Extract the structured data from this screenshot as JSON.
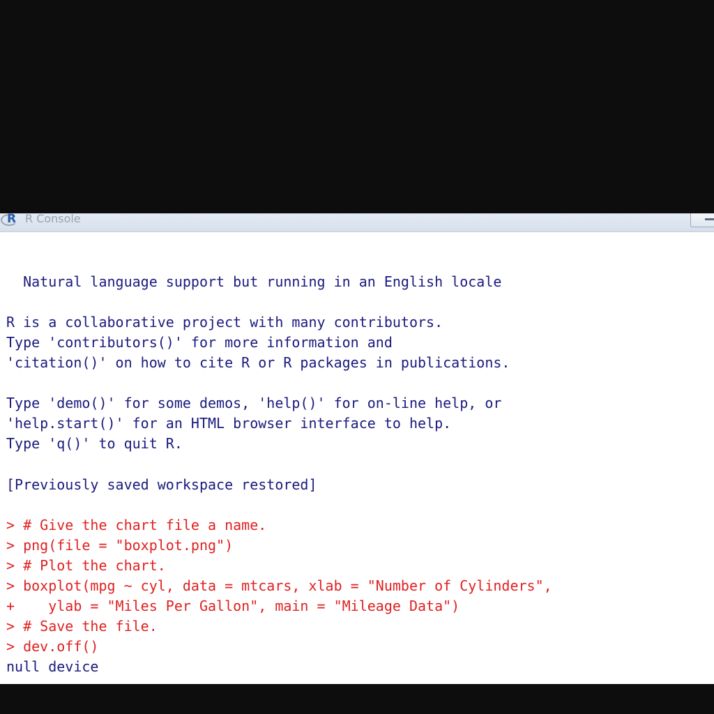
{
  "window": {
    "title": "R Console"
  },
  "console": {
    "lines": [
      {
        "text": "  Natural language support but running in an English locale",
        "kind": "output"
      },
      {
        "text": "R is a collaborative project with many contributors.",
        "kind": "output"
      },
      {
        "text": "Type 'contributors()' for more information and",
        "kind": "output"
      },
      {
        "text": "'citation()' on how to cite R or R packages in publications.",
        "kind": "output"
      },
      {
        "text": "Type 'demo()' for some demos, 'help()' for on-line help, or",
        "kind": "output"
      },
      {
        "text": "'help.start()' for an HTML browser interface to help.",
        "kind": "output"
      },
      {
        "text": "Type 'q()' to quit R.",
        "kind": "output"
      },
      {
        "text": "[Previously saved workspace restored]",
        "kind": "output"
      },
      {
        "text": "> # Give the chart file a name.",
        "kind": "input"
      },
      {
        "text": "> png(file = \"boxplot.png\")",
        "kind": "input"
      },
      {
        "text": "> # Plot the chart.",
        "kind": "input"
      },
      {
        "text": "> boxplot(mpg ~ cyl, data = mtcars, xlab = \"Number of Cylinders\",",
        "kind": "input"
      },
      {
        "text": "+    ylab = \"Miles Per Gallon\", main = \"Mileage Data\")",
        "kind": "input"
      },
      {
        "text": "> # Save the file.",
        "kind": "input"
      },
      {
        "text": "> dev.off()",
        "kind": "input"
      },
      {
        "text": "null device",
        "kind": "output"
      }
    ]
  },
  "colors": {
    "output_text": "#1a1a7e",
    "input_text": "#e02020",
    "background": "#ffffff",
    "frame": "#0d0d0d"
  },
  "icons": {
    "app": "r-logo-icon",
    "window_control": "minimize-icon"
  }
}
